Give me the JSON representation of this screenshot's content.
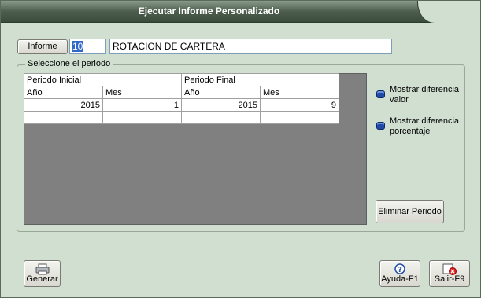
{
  "window": {
    "title": "Ejecutar Informe Personalizado"
  },
  "report": {
    "button_label": "Informe",
    "id_value": "10",
    "name_value": "ROTACION DE CARTERA"
  },
  "period": {
    "group_label": "Seleccione el periodo",
    "header_initial": "Periodo Inicial",
    "header_final": "Periodo Final",
    "col_year": "Año",
    "col_month": "Mes",
    "rows": [
      {
        "initial_year": "2015",
        "initial_month": "1",
        "final_year": "2015",
        "final_month": "9"
      },
      {
        "initial_year": "",
        "initial_month": "",
        "final_year": "",
        "final_month": ""
      }
    ]
  },
  "options": {
    "diff_value_label": "Mostrar diferencia valor",
    "diff_value_line1": "Mostrar diferencia",
    "diff_value_line2": "valor",
    "diff_pct_line1": "Mostrar diferencia",
    "diff_pct_line2": "porcentaje"
  },
  "buttons": {
    "eliminar": "Eliminar Periodo",
    "generar": "Generar",
    "ayuda": "Ayuda-F1",
    "salir": "Salir-F9"
  },
  "colors": {
    "title_bar": "#4e5e4e",
    "window_bg": "#d0dfd0",
    "grid_bg": "#808080",
    "check_blue": "#1f4aa8"
  }
}
